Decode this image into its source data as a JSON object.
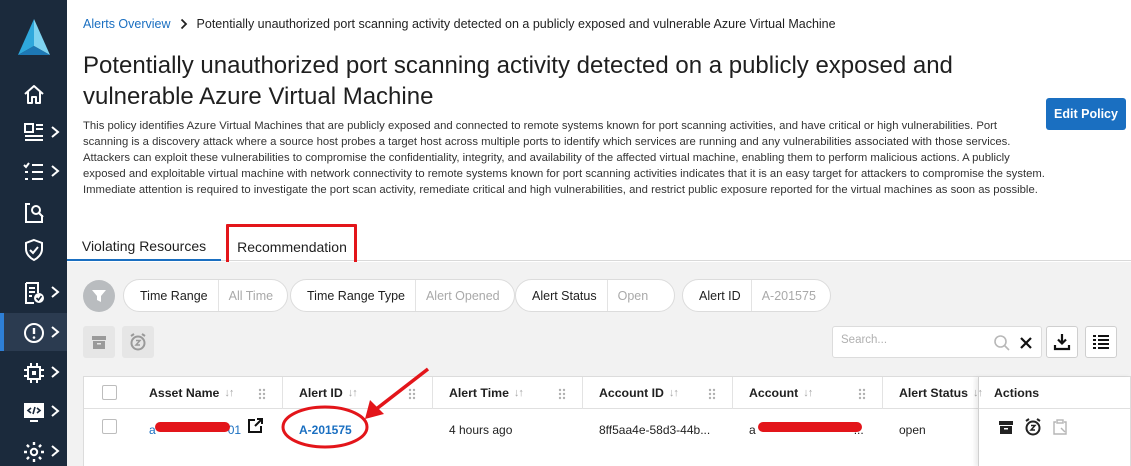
{
  "breadcrumb": {
    "parent": "Alerts Overview",
    "current": "Potentially unauthorized port scanning activity detected on a publicly exposed and vulnerable Azure Virtual Machine"
  },
  "title": "Potentially unauthorized port scanning activity detected on a publicly exposed and vulnerable Azure Virtual Machine",
  "description": "This policy identifies Azure Virtual Machines that are publicly exposed and connected to remote systems known for port scanning activities, and have critical or high vulnerabilities. Port scanning is a discovery attack where a source host probes a target host across multiple ports to identify which services are running and any vulnerabilities associated with those services. Attackers can exploit these vulnerabilities to compromise the confidentiality, integrity, and availability of the affected virtual machine, enabling them to perform malicious actions. A publicly exposed and exploitable virtual machine with network connectivity to remote systems known for port scanning activities indicates that it is an easy target for attackers to compromise the system. Immediate attention is required to investigate the port scan activity, remediate critical and high vulnerabilities, and restrict public exposure reported for the virtual machines as soon as possible.",
  "edit_button": "Edit Policy",
  "tabs": [
    "Violating Resources",
    "Recommendation"
  ],
  "filters": [
    {
      "label": "Time Range",
      "value": "All Time"
    },
    {
      "label": "Time Range Type",
      "value": "Alert Opened"
    },
    {
      "label": "Alert Status",
      "value": "Open"
    },
    {
      "label": "Alert ID",
      "value": "A-201575"
    }
  ],
  "search": {
    "placeholder": "Search..."
  },
  "table": {
    "columns": [
      "Asset Name",
      "Alert ID",
      "Alert Time",
      "Account ID",
      "Account",
      "Alert Status",
      "Actions"
    ],
    "rows": [
      {
        "asset_name_prefix": "a",
        "asset_name_suffix": "01",
        "alert_id": "A-201575",
        "alert_time": "4 hours ago",
        "account_id": "8ff5aa4e-58d3-44b...",
        "account_prefix": "a",
        "account_suffix": "...",
        "alert_status": "open"
      }
    ]
  },
  "colors": {
    "sidebar": "#1b2a3c",
    "accent": "#1a6fc1",
    "annotation": "#e3151a"
  },
  "icons": {
    "sidebar": [
      "logo-icon",
      "home-icon",
      "dashboard-icon",
      "checklist-icon",
      "investigate-icon",
      "shield-check-icon",
      "compliance-icon",
      "alerts-icon",
      "compute-icon",
      "code-icon",
      "settings-icon"
    ],
    "toolbar": [
      "archive-icon",
      "snooze-icon",
      "download-icon",
      "columns-icon"
    ]
  }
}
